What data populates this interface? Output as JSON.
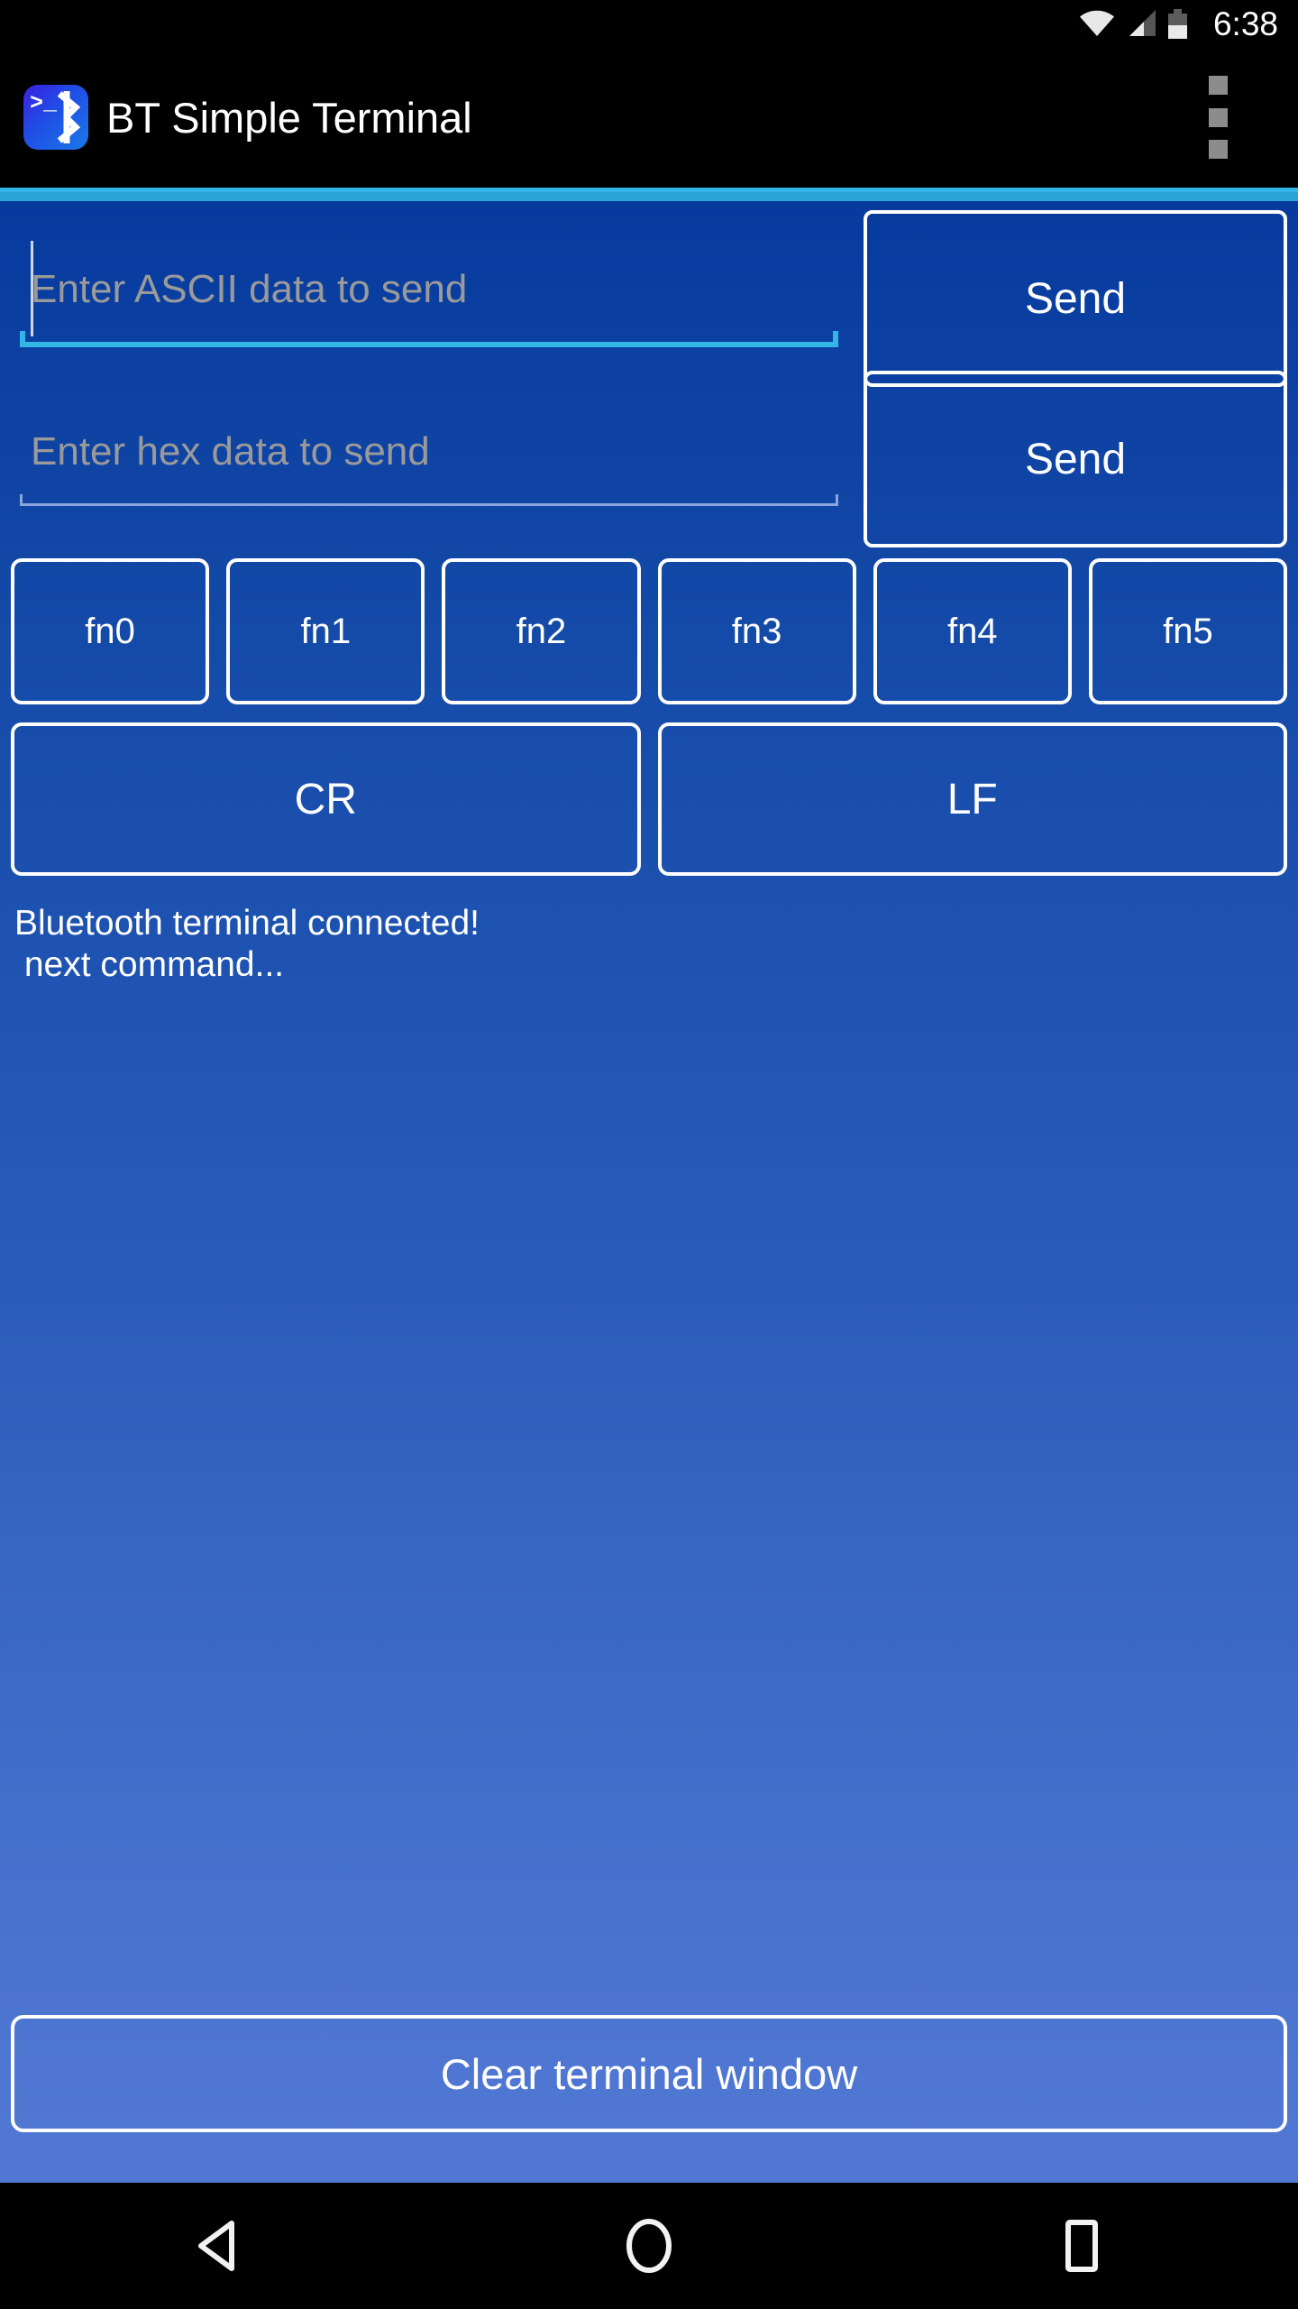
{
  "status_bar": {
    "time": "6:38",
    "wifi_icon": "wifi-icon",
    "signal_icon": "cell-signal-icon",
    "battery_icon": "battery-half-icon"
  },
  "action_bar": {
    "app_icon": "bluetooth-terminal-app-icon",
    "icon_prompt": ">_",
    "title": "BT Simple Terminal",
    "overflow_icon": "overflow-menu-icon"
  },
  "colors": {
    "accent": "#33b5e5",
    "content_top": "#073a9e",
    "content_bottom": "#5179d4",
    "button_border": "#ffffff",
    "hint_text": "#9a9a9a",
    "idle_underline": "#8ca6dd"
  },
  "main": {
    "ascii_field": {
      "placeholder": "Enter ASCII data to send",
      "value": "",
      "focused": true
    },
    "hex_field": {
      "placeholder": "Enter hex data to send",
      "value": "",
      "focused": false
    },
    "send_ascii_label": "Send",
    "send_hex_label": "Send",
    "fn_buttons": [
      {
        "label": "fn0"
      },
      {
        "label": "fn1"
      },
      {
        "label": "fn2"
      },
      {
        "label": "fn3"
      },
      {
        "label": "fn4"
      },
      {
        "label": "fn5"
      }
    ],
    "cr_label": "CR",
    "lf_label": "LF",
    "terminal_lines": [
      "Bluetooth terminal connected!",
      " next command..."
    ],
    "clear_label": "Clear terminal window"
  },
  "nav_bar": {
    "back_icon": "back-triangle-icon",
    "home_icon": "home-circle-icon",
    "recents_icon": "recents-square-icon"
  }
}
